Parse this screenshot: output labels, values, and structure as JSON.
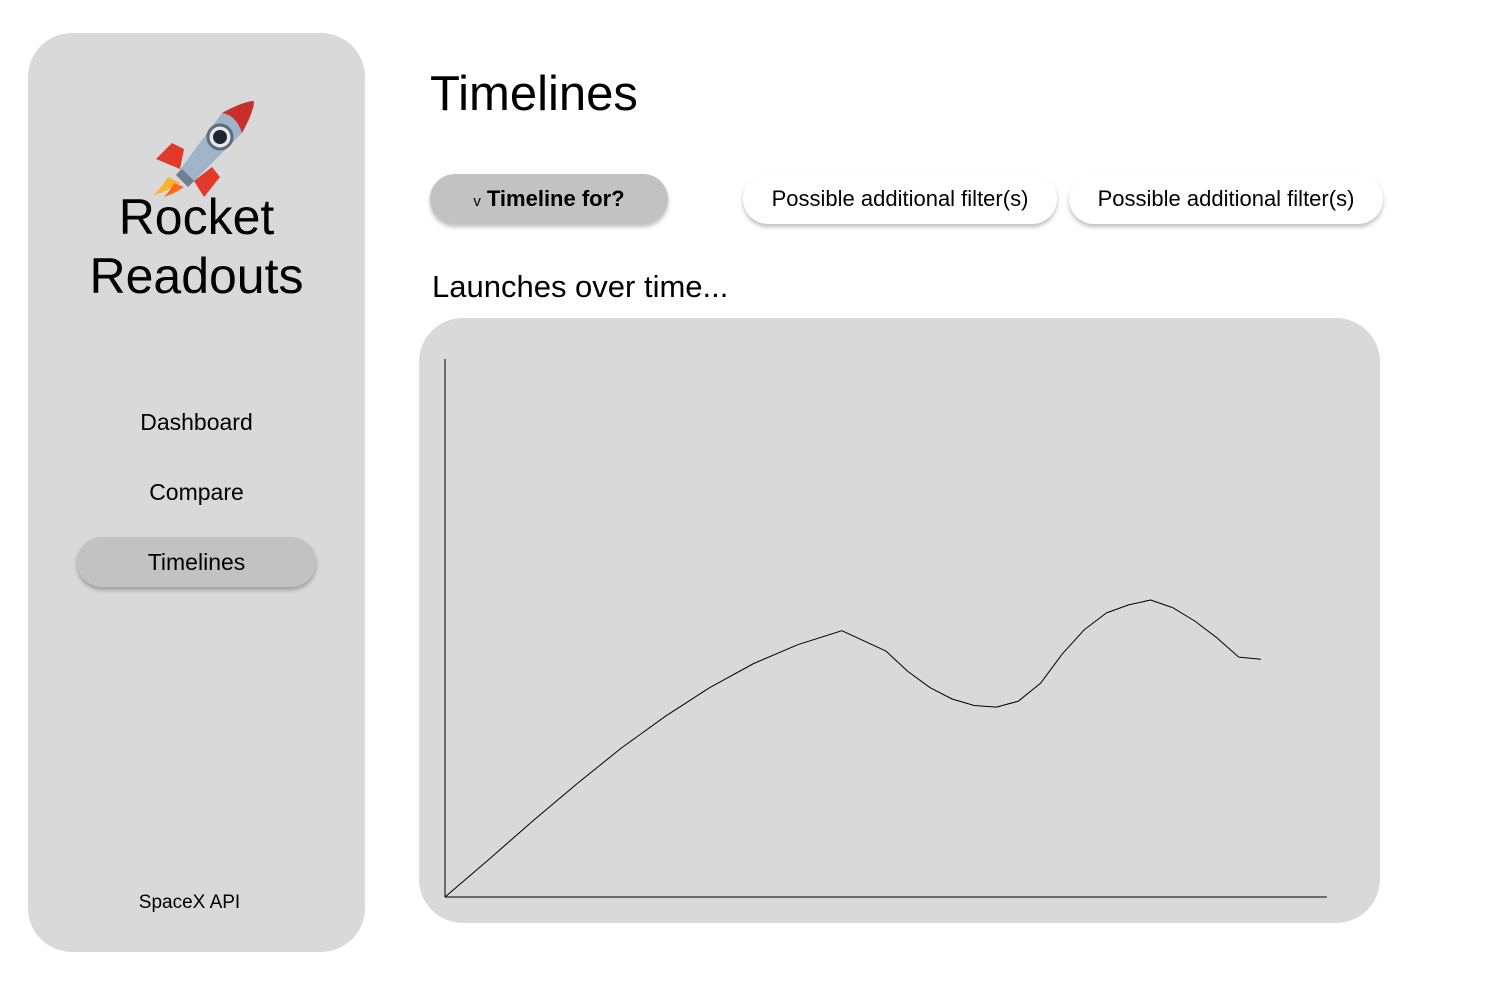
{
  "sidebar": {
    "logo_icon": "rocket-icon",
    "brand_line1": "Rocket",
    "brand_line2": "Readouts",
    "nav": [
      {
        "label": "Dashboard",
        "active": false
      },
      {
        "label": "Compare",
        "active": false
      },
      {
        "label": "Timelines",
        "active": true
      }
    ],
    "footer": "SpaceX API"
  },
  "main": {
    "title": "Timelines",
    "dropdown_caret": "v",
    "dropdown_label": "Timeline for?",
    "filters": [
      "Possible additional filter(s)",
      "Possible additional filter(s)"
    ],
    "chart_heading": "Launches over time..."
  },
  "colors": {
    "panel": "#d9d9d9",
    "active": "#c2c2c2"
  },
  "chart_data": {
    "type": "line",
    "series": [
      {
        "x": [
          0,
          5,
          10,
          15,
          20,
          25,
          30,
          35,
          40,
          45,
          50,
          52.5,
          55,
          57.5,
          60,
          62.5,
          65,
          67.5,
          70,
          72.5,
          75,
          77.5,
          80,
          82.5,
          85,
          87.5,
          90,
          92.5
        ],
        "y": [
          0,
          7,
          14.2,
          21.1,
          27.7,
          33.6,
          38.9,
          43.4,
          46.9,
          49.5,
          45.7,
          41.9,
          38.9,
          36.8,
          35.6,
          35.3,
          36.4,
          39.7,
          45.2,
          49.7,
          52.8,
          54.3,
          55.2,
          53.8,
          51.3,
          48.2,
          44.6,
          44.2
        ]
      }
    ],
    "xlim": [
      0,
      100
    ],
    "ylim": [
      0,
      100
    ],
    "grid": false
  }
}
